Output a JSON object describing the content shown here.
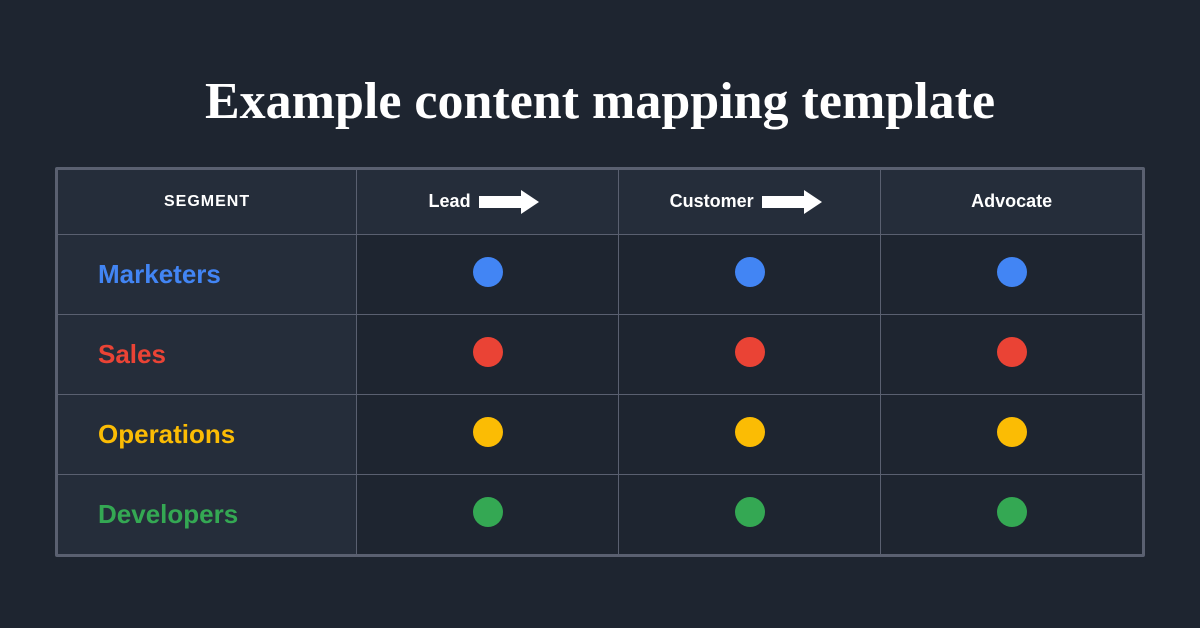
{
  "page": {
    "title": "Example content mapping template",
    "background": "#1e2530"
  },
  "table": {
    "headers": {
      "segment": "SEGMENT",
      "lead": "Lead",
      "customer": "Customer",
      "advocate": "Advocate"
    },
    "rows": [
      {
        "label": "Marketers",
        "color_class": "color-blue",
        "dot_class": "dot-blue"
      },
      {
        "label": "Sales",
        "color_class": "color-red",
        "dot_class": "dot-red"
      },
      {
        "label": "Operations",
        "color_class": "color-yellow",
        "dot_class": "dot-yellow"
      },
      {
        "label": "Developers",
        "color_class": "color-green",
        "dot_class": "dot-green"
      }
    ]
  }
}
